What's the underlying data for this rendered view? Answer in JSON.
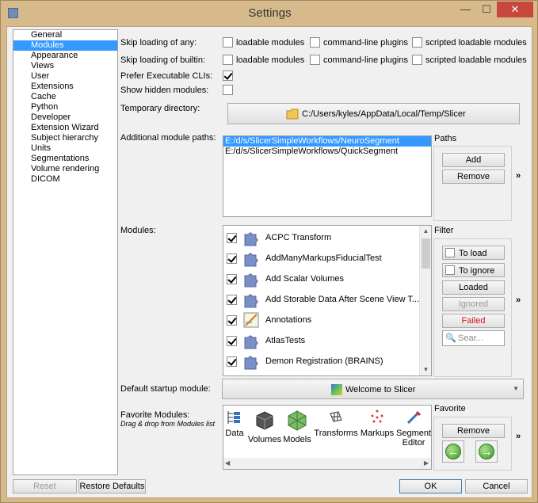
{
  "window": {
    "title": "Settings",
    "minimize": "—",
    "maximize": "☐",
    "close": "✕"
  },
  "nav": {
    "items": [
      "General",
      "Modules",
      "Appearance",
      "Views",
      "User",
      "Extensions",
      "Cache",
      "Python",
      "Developer",
      "Extension Wizard",
      "Subject hierarchy",
      "Units",
      "Segmentations",
      "Volume rendering",
      "DICOM"
    ],
    "selected": "Modules"
  },
  "skip_any": {
    "label": "Skip loading of any:",
    "opt1": "loadable modules",
    "opt2": "command-line plugins",
    "opt3": "scripted loadable modules"
  },
  "skip_builtin": {
    "label": "Skip loading of builtin:",
    "opt1": "loadable modules",
    "opt2": "command-line plugins",
    "opt3": "scripted loadable modules"
  },
  "prefer_cli": {
    "label": "Prefer Executable CLIs:",
    "checked": true
  },
  "show_hidden": {
    "label": "Show hidden modules:",
    "checked": false
  },
  "temp_dir": {
    "label": "Temporary directory:",
    "value": "C:/Users/kyles/AppData/Local/Temp/Slicer"
  },
  "paths": {
    "label": "Additional module paths:",
    "items": [
      "E:/d/s/SlicerSimpleWorkflows/NeuroSegment",
      "E:/d/s/SlicerSimpleWorkflows/QuickSegment"
    ],
    "group_title": "Paths",
    "add": "Add",
    "remove": "Remove",
    "more": "»"
  },
  "modules": {
    "label": "Modules:",
    "items": [
      "ACPC Transform",
      "AddManyMarkupsFiducialTest",
      "Add Scalar Volumes",
      "Add Storable Data After Scene View T...",
      "Annotations",
      "AtlasTests",
      "Demon Registration (BRAINS)"
    ],
    "filter_title": "Filter",
    "to_load": "To load",
    "to_ignore": "To ignore",
    "loaded": "Loaded",
    "ignored": "Ignored",
    "failed": "Failed",
    "search_placeholder": "Sear...",
    "more": "»",
    "failed_color": "#e0101a"
  },
  "startup": {
    "label": "Default startup module:",
    "value": "Welcome to Slicer"
  },
  "favorites": {
    "label": "Favorite Modules:",
    "hint": "Drag & drop from Modules list",
    "items": [
      "Data",
      "Volumes",
      "Models",
      "Transforms",
      "Markups",
      "Segment Editor"
    ],
    "group_title": "Favorite",
    "remove": "Remove",
    "more": "»"
  },
  "footer": {
    "reset": "Reset",
    "restore": "Restore Defaults",
    "ok": "OK",
    "cancel": "Cancel"
  }
}
